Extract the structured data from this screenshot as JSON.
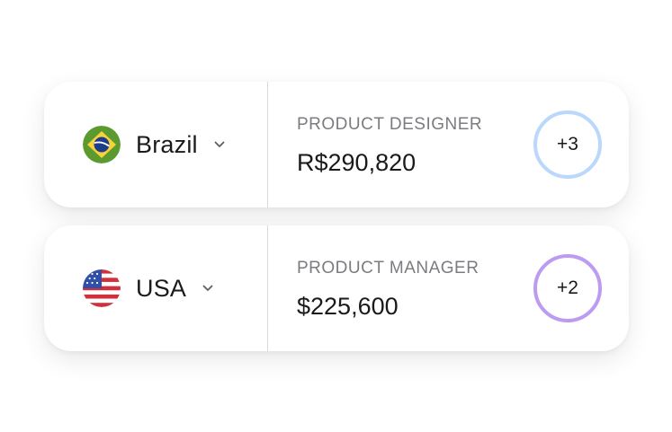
{
  "rows": [
    {
      "country": "Brazil",
      "flag_icon": "brazil-flag-icon",
      "role": "PRODUCT DESIGNER",
      "salary": "R$290,820",
      "badge": "+3",
      "badge_color": "#b9d8fb"
    },
    {
      "country": "USA",
      "flag_icon": "usa-flag-icon",
      "role": "PRODUCT MANAGER",
      "salary": "$225,600",
      "badge": "+2",
      "badge_color": "#bc9bf2"
    }
  ],
  "colors": {
    "text": "#1a1a1a",
    "muted": "#7c7c80",
    "divider": "#d9d9dc",
    "brazil_green": "#5b9a2e",
    "brazil_yellow": "#f7d23b",
    "brazil_blue": "#1f3c8a",
    "usa_red": "#d22f3b",
    "usa_blue": "#2f4fa8"
  }
}
